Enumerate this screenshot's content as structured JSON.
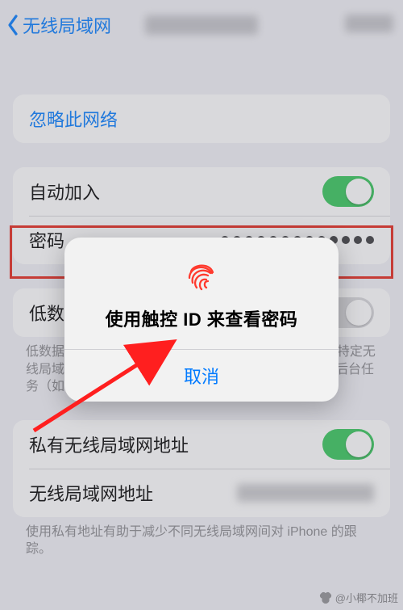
{
  "header": {
    "back_label": "无线局域网"
  },
  "group_ignore": {
    "label": "忽略此网络"
  },
  "group_join": {
    "auto_join_label": "自动加入",
    "auto_join_on": true,
    "password_label": "密码",
    "password_dot_count": 13
  },
  "group_lowdata": {
    "label": "低数据模式",
    "caption": "低数据模式有助于减少iPhone通过蜂窝网络或您选择的特定无线局域网使用的数据。打开低数据模式后，自动更新和后台任务（如\"照片\"同步）会暂停。"
  },
  "group_private": {
    "private_label": "私有无线局域网地址",
    "private_on": true,
    "wifi_addr_label": "无线局域网地址",
    "caption": "使用私有地址有助于减少不同无线局域网间对 iPhone 的跟踪。"
  },
  "dialog": {
    "title": "使用触控 ID 来查看密码",
    "cancel": "取消"
  },
  "watermark": "@小椰不加班",
  "colors": {
    "accent": "#007aff",
    "switch_on": "#34c759",
    "highlight": "#e52619"
  }
}
